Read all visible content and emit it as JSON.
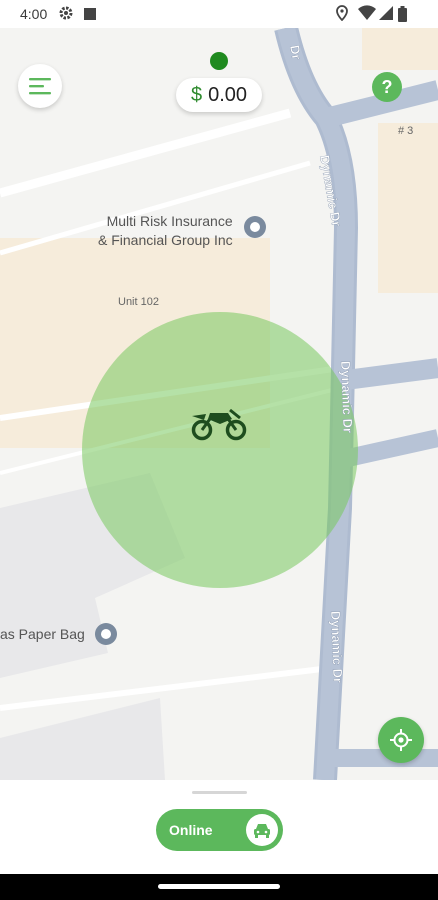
{
  "status_bar": {
    "time": "4:00",
    "left_icons": [
      "settings-icon",
      "square-icon"
    ],
    "right_icons": [
      "location-icon",
      "wifi-icon",
      "signal-icon",
      "battery-icon"
    ]
  },
  "map": {
    "road_labels": [
      "Dr",
      "Dynamic Dr",
      "Dynamic Dr",
      "Dynamic Dr"
    ],
    "pois": [
      {
        "name_line1": "Multi Risk Insurance",
        "name_line2": "& Financial Group Inc"
      },
      {
        "name_line1": "as Paper Bag",
        "name_line2": ""
      }
    ],
    "unit_label": "Unit 102",
    "building_number": "# 3",
    "vehicle": "motorcycle-icon"
  },
  "header": {
    "menu_icon": "menu-icon",
    "status_dot_color": "#1f8a1f",
    "balance_currency": "$",
    "balance_amount": "0.00",
    "help_label": "?"
  },
  "controls": {
    "locate_icon": "crosshair-icon"
  },
  "bottom_sheet": {
    "toggle_label": "Online",
    "toggle_icon": "car-icon",
    "accent_color": "#5cb85c"
  }
}
